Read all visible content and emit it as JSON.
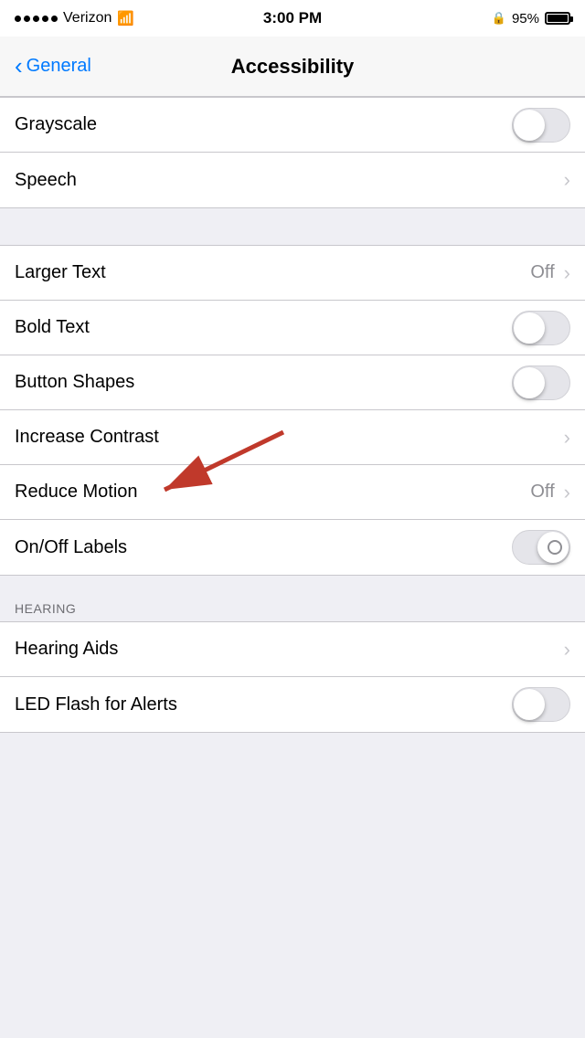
{
  "statusBar": {
    "carrier": "Verizon",
    "time": "3:00 PM",
    "lockIcon": "🔒",
    "battery": "95%"
  },
  "navBar": {
    "backLabel": "General",
    "title": "Accessibility"
  },
  "sections": [
    {
      "id": "vision-lower",
      "rows": [
        {
          "id": "grayscale",
          "label": "Grayscale",
          "type": "toggle",
          "value": false,
          "showChevron": false
        },
        {
          "id": "speech",
          "label": "Speech",
          "type": "chevron",
          "value": null,
          "showChevron": true
        }
      ]
    },
    {
      "id": "text-section",
      "rows": [
        {
          "id": "larger-text",
          "label": "Larger Text",
          "type": "value-chevron",
          "value": "Off",
          "showChevron": true
        },
        {
          "id": "bold-text",
          "label": "Bold Text",
          "type": "toggle",
          "value": false,
          "showChevron": false
        },
        {
          "id": "button-shapes",
          "label": "Button Shapes",
          "type": "toggle",
          "value": false,
          "showChevron": false
        },
        {
          "id": "increase-contrast",
          "label": "Increase Contrast",
          "type": "chevron",
          "value": null,
          "showChevron": true
        },
        {
          "id": "reduce-motion",
          "label": "Reduce Motion",
          "type": "value-chevron",
          "value": "Off",
          "showChevron": true
        },
        {
          "id": "onoff-labels",
          "label": "On/Off Labels",
          "type": "toggle-offside",
          "value": false,
          "showChevron": false
        }
      ]
    },
    {
      "id": "hearing-section",
      "header": "HEARING",
      "rows": [
        {
          "id": "hearing-aids",
          "label": "Hearing Aids",
          "type": "chevron",
          "value": null,
          "showChevron": true
        },
        {
          "id": "led-flash",
          "label": "LED Flash for Alerts",
          "type": "toggle",
          "value": false,
          "showChevron": false
        }
      ]
    }
  ],
  "arrow": {
    "visible": true,
    "color": "#c0392b"
  }
}
